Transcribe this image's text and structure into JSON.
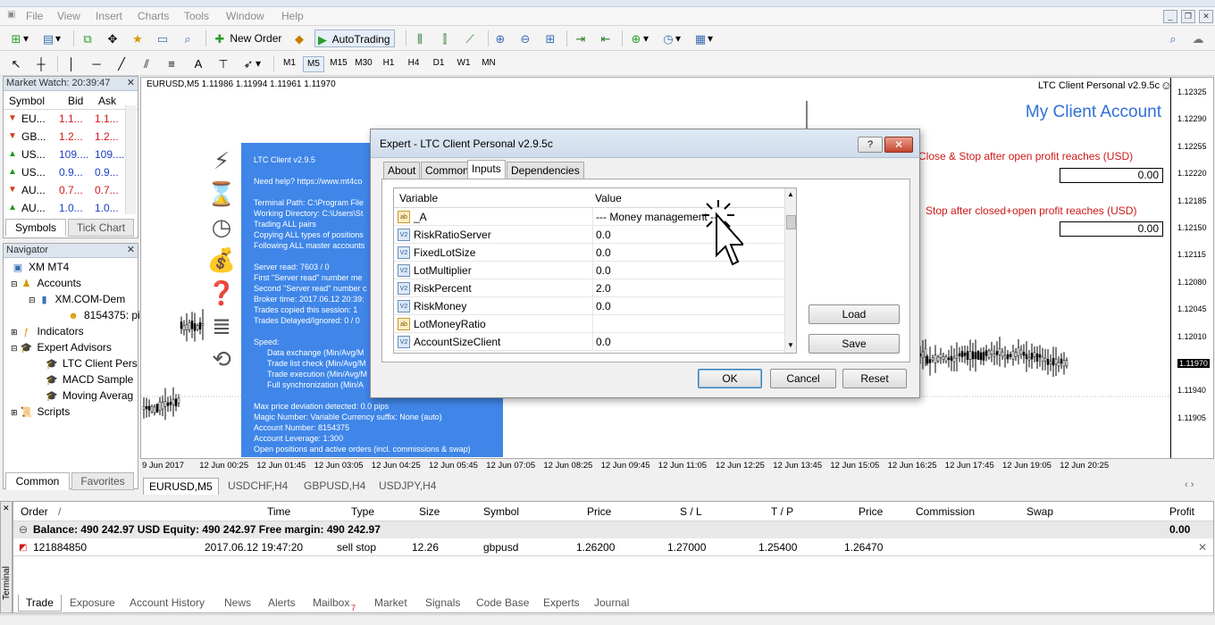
{
  "window": {
    "title": "LTC Client Personal v2.9.5c"
  },
  "menu": [
    "File",
    "View",
    "Insert",
    "Charts",
    "Tools",
    "Window",
    "Help"
  ],
  "toolbar": {
    "new_order": "New Order",
    "autotrading": "AutoTrading",
    "timeframes": [
      "M1",
      "M5",
      "M15",
      "M30",
      "H1",
      "H4",
      "D1",
      "W1",
      "MN"
    ],
    "active_tf": "M5"
  },
  "market_watch": {
    "title": "Market Watch: 20:39:47",
    "headers": [
      "Symbol",
      "Bid",
      "Ask"
    ],
    "rows": [
      {
        "symbol": "EU...",
        "bid": "1.1...",
        "ask": "1.1...",
        "dir": "down"
      },
      {
        "symbol": "GB...",
        "bid": "1.2...",
        "ask": "1.2...",
        "dir": "down"
      },
      {
        "symbol": "US...",
        "bid": "109....",
        "ask": "109....",
        "dir": "up"
      },
      {
        "symbol": "US...",
        "bid": "0.9...",
        "ask": "0.9...",
        "dir": "up"
      },
      {
        "symbol": "AU...",
        "bid": "0.7...",
        "ask": "0.7...",
        "dir": "down"
      },
      {
        "symbol": "AU...",
        "bid": "1.0...",
        "ask": "1.0...",
        "dir": "up"
      }
    ],
    "tabs": [
      "Symbols",
      "Tick Chart"
    ]
  },
  "navigator": {
    "title": "Navigator",
    "items": [
      {
        "label": "XM MT4",
        "icon": "terminal-icon"
      },
      {
        "label": "Accounts",
        "icon": "accounts-icon"
      },
      {
        "label": "XM.COM-Dem",
        "icon": "server-icon"
      },
      {
        "label": "8154375: pi",
        "icon": "user-icon"
      },
      {
        "label": "Indicators",
        "icon": "indicators-icon"
      },
      {
        "label": "Expert Advisors",
        "icon": "expert-icon"
      },
      {
        "label": "LTC Client Pers",
        "icon": "expert-icon"
      },
      {
        "label": "MACD Sample",
        "icon": "expert-icon"
      },
      {
        "label": "Moving Averag",
        "icon": "expert-icon"
      },
      {
        "label": "Scripts",
        "icon": "scripts-icon"
      }
    ],
    "tabs": [
      "Common",
      "Favorites"
    ]
  },
  "chart": {
    "header": "EURUSD,M5  1.11986 1.11994 1.11961 1.11970",
    "ea_name": "LTC Client Personal v2.9.5c",
    "account_title": "My Client Account",
    "label1": "Close & Stop after open profit reaches (USD)",
    "value1": "0.00",
    "label2": "Stop after closed+open profit reaches (USD)",
    "value2": "0.00",
    "price_axis": [
      "1.12325",
      "1.12290",
      "1.12255",
      "1.12220",
      "1.12185",
      "1.12150",
      "1.12115",
      "1.12080",
      "1.12045",
      "1.12010",
      "1.11970",
      "1.11940",
      "1.11905"
    ],
    "current_price": "1.11970",
    "time_axis": [
      "9 Jun 2017",
      "12 Jun 00:25",
      "12 Jun 01:45",
      "12 Jun 03:05",
      "12 Jun 04:25",
      "12 Jun 05:45",
      "12 Jun 07:05",
      "12 Jun 08:25",
      "12 Jun 09:45",
      "12 Jun 11:05",
      "12 Jun 12:25",
      "12 Jun 13:45",
      "12 Jun 15:05",
      "12 Jun 16:25",
      "12 Jun 17:45",
      "12 Jun 19:05",
      "12 Jun 20:25"
    ],
    "tabs": [
      "EURUSD,M5",
      "USDCHF,H4",
      "GBPUSD,H4",
      "USDJPY,H4"
    ]
  },
  "info_panel": {
    "lines": [
      "LTC Client v2.9.5",
      "Need help? https://www.mt4co",
      "Terminal Path: C:\\Program File",
      "Working Directory: C:\\Users\\St",
      "Trading ALL pairs",
      "Copying ALL types of positions",
      "Following ALL master accounts",
      "Server read: 7603 / 0",
      "First \"Server read\" number me",
      "Second \"Server read\" number c",
      "Broker time: 2017.06.12 20:39:",
      "Trades copied this session: 1",
      "Trades Delayed/Ignored: 0 / 0",
      "Speed:",
      "Data exchange (Min/Avg/M",
      "Trade list check (Min/Avg/M",
      "Trade execution (Min/Avg/M",
      "Full synchronization (Min/A",
      "Max price deviation detected: 0.0 pips",
      "Magic Number: Variable     Currency suffix: None (auto)",
      "Account Number: 8154375",
      "Account Leverage: 1:300",
      "Open positions and active orders (incl. commissions & swap)"
    ]
  },
  "dialog": {
    "title": "Expert - LTC Client Personal v2.9.5c",
    "tabs": [
      "About",
      "Common",
      "Inputs",
      "Dependencies"
    ],
    "active_tab": "Inputs",
    "headers": [
      "Variable",
      "Value"
    ],
    "rows": [
      {
        "name": "_A",
        "value": "--- Money management ---",
        "type": "ab"
      },
      {
        "name": "RiskRatioServer",
        "value": "0.0",
        "type": "v2"
      },
      {
        "name": "FixedLotSize",
        "value": "0.0",
        "type": "v2"
      },
      {
        "name": "LotMultiplier",
        "value": "0.0",
        "type": "v2"
      },
      {
        "name": "RiskPercent",
        "value": "2.0",
        "type": "v2"
      },
      {
        "name": "RiskMoney",
        "value": "0.0",
        "type": "v2"
      },
      {
        "name": "LotMoneyRatio",
        "value": "",
        "type": "ab"
      },
      {
        "name": "AccountSizeClient",
        "value": "0.0",
        "type": "v2"
      }
    ],
    "load": "Load",
    "save": "Save",
    "ok": "OK",
    "cancel": "Cancel",
    "reset": "Reset",
    "help": "?"
  },
  "terminal": {
    "headers": [
      "Order",
      "Time",
      "Type",
      "Size",
      "Symbol",
      "Price",
      "S / L",
      "T / P",
      "Price",
      "Commission",
      "Swap",
      "Profit"
    ],
    "balance_line": "Balance: 490 242.97 USD  Equity: 490 242.97  Free margin: 490 242.97",
    "balance_profit": "0.00",
    "order": {
      "order": "121884850",
      "time": "2017.06.12 19:47:20",
      "type": "sell stop",
      "size": "12.26",
      "symbol": "gbpusd",
      "price": "1.26200",
      "sl": "1.27000",
      "tp": "1.25400",
      "cur_price": "1.26470"
    },
    "tabs": [
      "Trade",
      "Exposure",
      "Account History",
      "News",
      "Alerts",
      "Mailbox",
      "Market",
      "Signals",
      "Code Base",
      "Experts",
      "Journal"
    ],
    "mailbox_badge": "7",
    "side_label": "Terminal"
  }
}
